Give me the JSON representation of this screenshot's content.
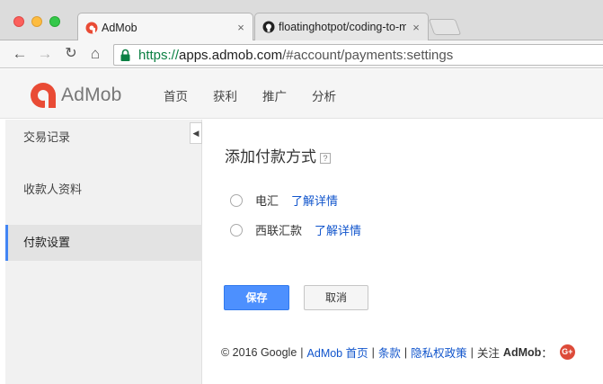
{
  "browser": {
    "tabs": [
      {
        "title": "AdMob",
        "icon": "admob-favicon",
        "close": "×"
      },
      {
        "title": "floatinghotpot/coding-to-m",
        "icon": "github-favicon",
        "close": "×"
      }
    ],
    "url": {
      "scheme": "https://",
      "host": "apps.admob.com",
      "path": "/#account/payments:settings"
    },
    "nav": {
      "back": "←",
      "forward": "→",
      "reload": "↻",
      "home": "⌂"
    }
  },
  "header": {
    "logo_text": "AdMob",
    "nav": [
      "首页",
      "获利",
      "推广",
      "分析"
    ]
  },
  "sidebar": {
    "items": [
      {
        "label": "交易记录"
      },
      {
        "label": "收款人资料"
      },
      {
        "label": "付款设置"
      }
    ],
    "collapse": "◀"
  },
  "main": {
    "title": "添加付款方式",
    "help": "?",
    "options": [
      {
        "label": "电汇",
        "link": "了解详情"
      },
      {
        "label": "西联汇款",
        "link": "了解详情"
      }
    ],
    "save_label": "保存",
    "cancel_label": "取消"
  },
  "footer": {
    "copyright": "© 2016 Google",
    "sep": "|",
    "links": [
      "AdMob 首页",
      "条款",
      "隐私权政策"
    ],
    "follow": "关注",
    "follow_brand": "AdMob",
    "follow_colon": "：",
    "gplus": "G+"
  },
  "colors": {
    "accent": "#4285f4",
    "save_button": "#4d90fe",
    "link": "#1155cc",
    "logo_red": "#e94b35",
    "gplus": "#dd4b39"
  }
}
